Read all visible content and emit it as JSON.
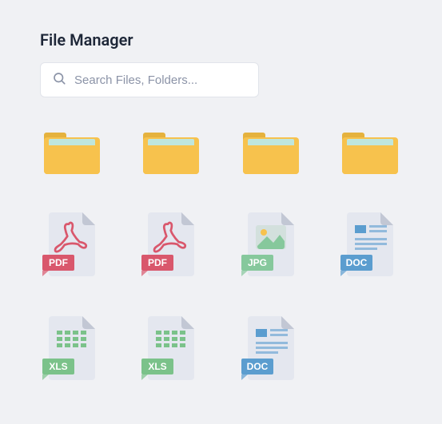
{
  "title": "File Manager",
  "search": {
    "placeholder": "Search Files, Folders..."
  },
  "items": [
    {
      "kind": "folder"
    },
    {
      "kind": "folder"
    },
    {
      "kind": "folder"
    },
    {
      "kind": "folder"
    },
    {
      "kind": "pdf",
      "label": "PDF"
    },
    {
      "kind": "pdf",
      "label": "PDF"
    },
    {
      "kind": "jpg",
      "label": "JPG"
    },
    {
      "kind": "doc",
      "label": "DOC"
    },
    {
      "kind": "xls",
      "label": "XLS"
    },
    {
      "kind": "xls",
      "label": "XLS"
    },
    {
      "kind": "doc",
      "label": "DOC"
    }
  ],
  "colors": {
    "pdf": "#d9576c",
    "jpg": "#86c89c",
    "doc": "#5b9dcf",
    "xls": "#7bc28a",
    "paper": "#e4e7ef",
    "paperFold": "#c2c7d4",
    "folderBody": "#f7c24d",
    "folderTab": "#e5b23e",
    "folderSheet": "#bfe6dd"
  }
}
